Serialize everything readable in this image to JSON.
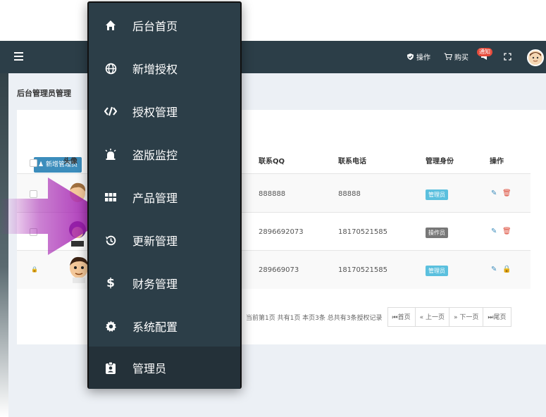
{
  "navbar": {
    "operate": "操作",
    "buy": "购买",
    "notify_badge": "通知"
  },
  "page": {
    "title": "后台管理员管理"
  },
  "toolbar": {
    "add_admin": "新增管理员"
  },
  "table": {
    "headers": {
      "avatar": "头像",
      "qq": "联系QQ",
      "phone": "联系电话",
      "role": "管理身份",
      "actions": "操作"
    },
    "rows": [
      {
        "qq": "888888",
        "phone": "88888",
        "role": "管理员",
        "role_color": "#5bc0de"
      },
      {
        "qq": "2896692073",
        "phone": "18170521585",
        "role": "操作员",
        "role_color": "#777777"
      },
      {
        "qq": "289669073",
        "phone": "18170521585",
        "role": "管理员",
        "role_color": "#5bc0de"
      }
    ]
  },
  "pager": {
    "info": "当前第1页  共有1页  本页3条  总共有3条授权记录",
    "first": "首页",
    "prev": "« 上一页",
    "next": "» 下一页",
    "last": "尾页"
  },
  "menu": {
    "items": [
      {
        "label": "后台首页",
        "icon": "home-icon"
      },
      {
        "label": "新增授权",
        "icon": "globe-icon"
      },
      {
        "label": "授权管理",
        "icon": "code-icon"
      },
      {
        "label": "盗版监控",
        "icon": "alarm-icon"
      },
      {
        "label": "产品管理",
        "icon": "grid-icon"
      },
      {
        "label": "更新管理",
        "icon": "history-icon"
      },
      {
        "label": "财务管理",
        "icon": "dollar-icon"
      },
      {
        "label": "系统配置",
        "icon": "gear-icon"
      },
      {
        "label": "管理员",
        "icon": "id-badge-icon"
      }
    ],
    "active_index": 8
  },
  "colors": {
    "navbar": "#2c3e48",
    "menu_bg": "#2c3e48",
    "primary": "#3c8dbc",
    "danger": "#dd4b39",
    "arrow": "#a21caf"
  }
}
